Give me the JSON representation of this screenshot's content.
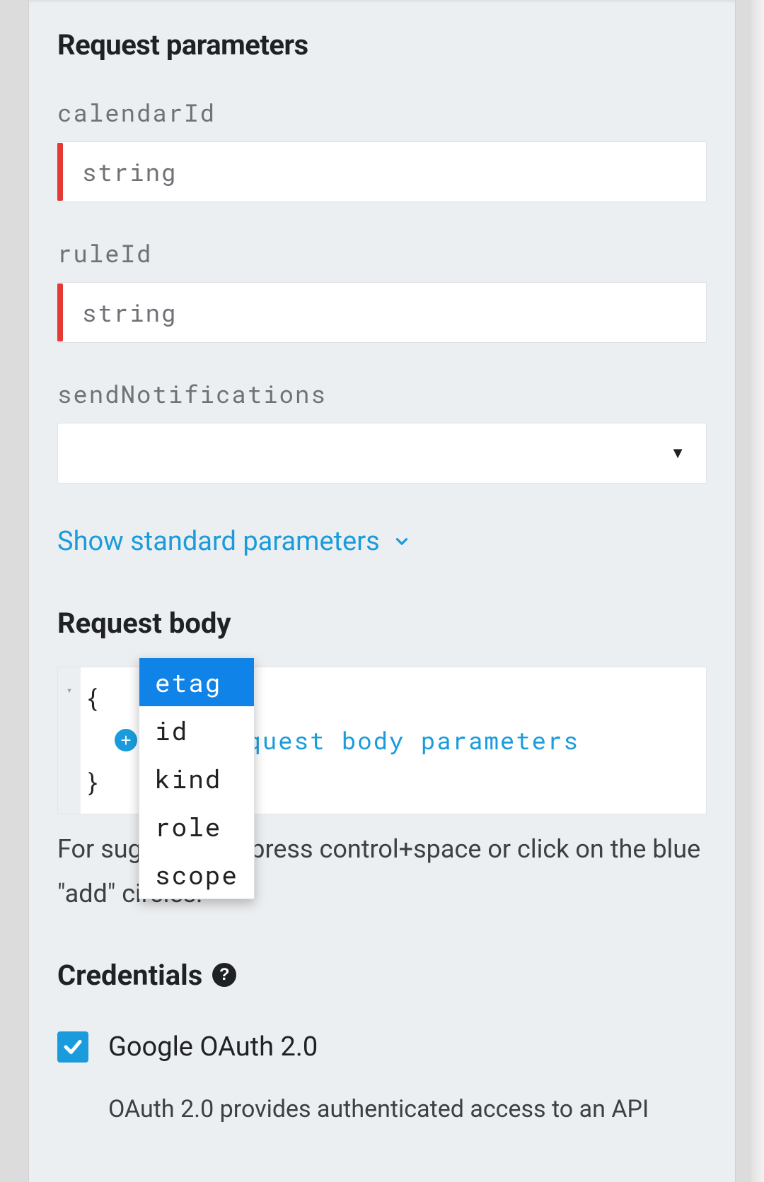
{
  "sections": {
    "params_heading": "Request parameters",
    "body_heading": "Request body",
    "credentials_heading": "Credentials"
  },
  "params": {
    "calendarId": {
      "label": "calendarId",
      "placeholder": "string",
      "required": true
    },
    "ruleId": {
      "label": "ruleId",
      "placeholder": "string",
      "required": true
    },
    "sendNotifications": {
      "label": "sendNotifications",
      "value": ""
    }
  },
  "links": {
    "show_standard": "Show standard parameters"
  },
  "json_editor": {
    "open_brace": "{",
    "close_brace": "}",
    "add_label": "Add request body parameters"
  },
  "autocomplete": {
    "items": [
      "etag",
      "id",
      "kind",
      "role",
      "scope"
    ],
    "selected": "etag"
  },
  "hint": "For suggestions, press control+space or click on the blue \"add\" circles.",
  "credentials": {
    "oauth_label": "Google OAuth 2.0",
    "oauth_checked": true,
    "cutoff_text": "OAuth 2.0 provides authenticated access to an API"
  }
}
